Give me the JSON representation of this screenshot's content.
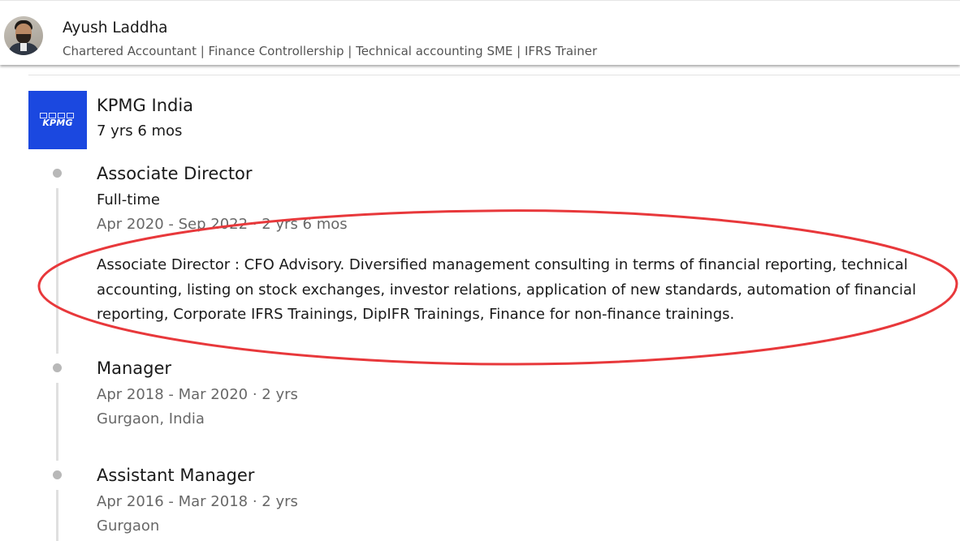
{
  "header": {
    "name": "Ayush Laddha",
    "headline": "Chartered Accountant | Finance Controllership | Technical accounting SME | IFRS Trainer"
  },
  "company": {
    "logo_text": "KPMG",
    "name": "KPMG India",
    "duration": "7 yrs 6 mos",
    "brand_color": "#1b48e0"
  },
  "positions": [
    {
      "title": "Associate Director",
      "employment_type": "Full-time",
      "dates": "Apr 2020 - Sep 2022 · 2 yrs 6 mos",
      "description": "Associate Director : CFO Advisory. Diversified management consulting in terms of financial reporting, technical accounting, listing on stock exchanges, investor relations, application of new standards, automation of financial reporting, Corporate IFRS Trainings, DipIFR Trainings, Finance for non-finance trainings."
    },
    {
      "title": "Manager",
      "dates": "Apr 2018 - Mar 2020 · 2 yrs",
      "location": "Gurgaon, India"
    },
    {
      "title": "Assistant Manager",
      "dates": "Apr 2016 - Mar 2018 · 2 yrs",
      "location": "Gurgaon"
    }
  ],
  "annotation_color": "#e8383b"
}
